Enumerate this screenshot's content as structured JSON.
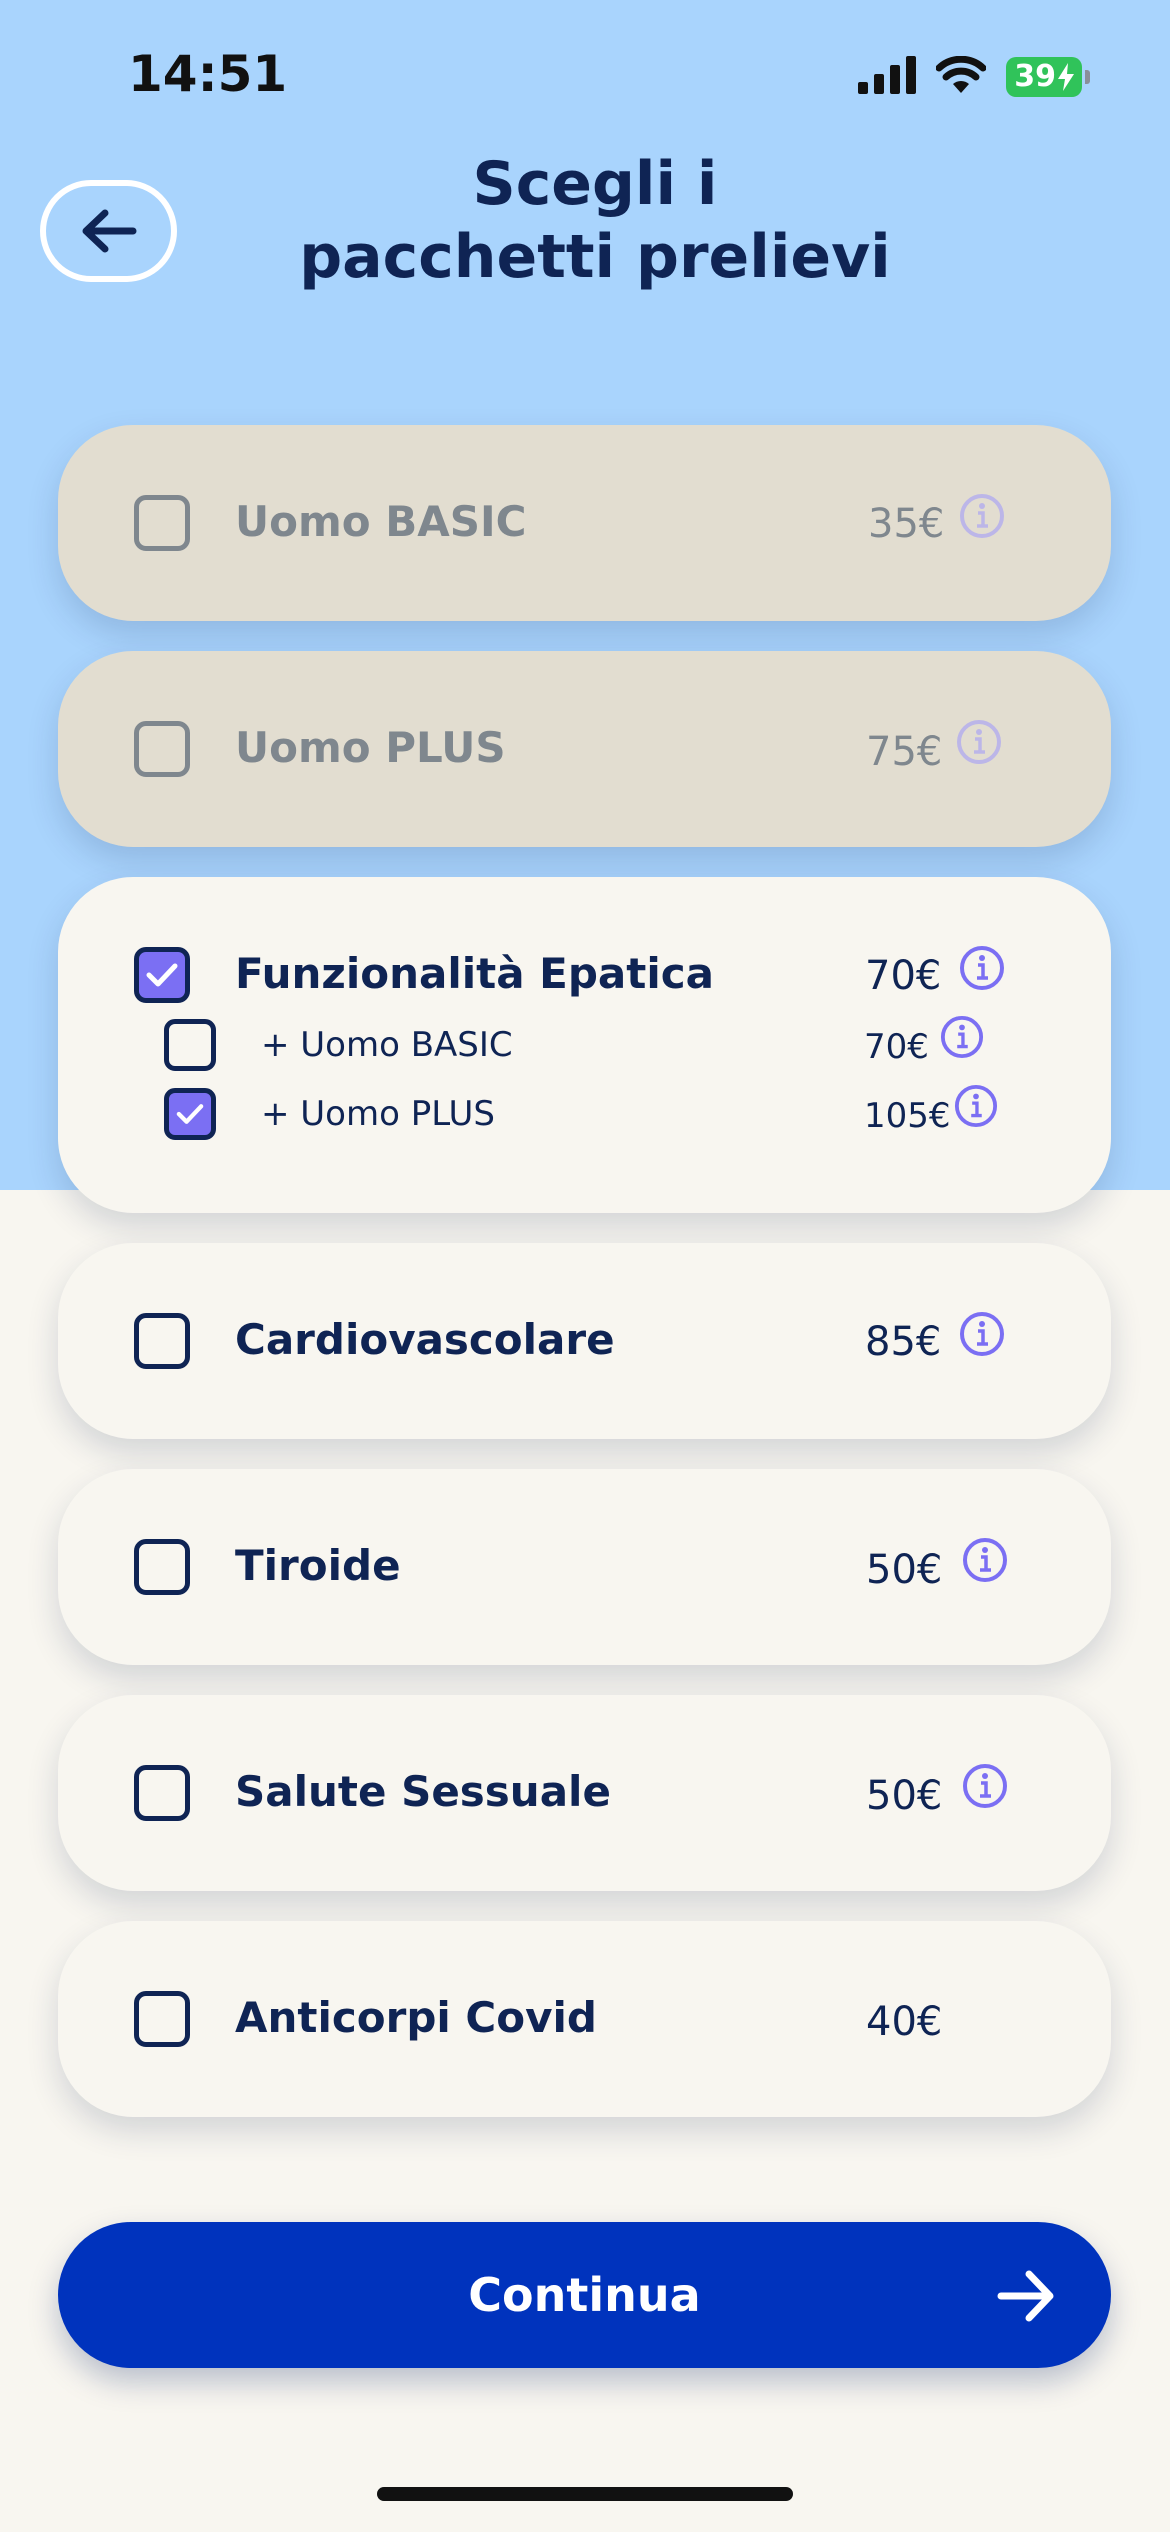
{
  "status_bar": {
    "time": "14:51",
    "battery": "39"
  },
  "header": {
    "title_line1": "Scegli i",
    "title_line2": "pacchetti prelievi"
  },
  "packages": [
    {
      "label": "Uomo BASIC",
      "price": "35€",
      "checked": false,
      "enabled": false
    },
    {
      "label": "Uomo PLUS",
      "price": "75€",
      "checked": false,
      "enabled": false
    },
    {
      "label": "Funzionalità Epatica",
      "price": "70€",
      "checked": true,
      "enabled": true,
      "addons": [
        {
          "label": "+ Uomo BASIC",
          "price": "70€",
          "checked": false
        },
        {
          "label": "+ Uomo PLUS",
          "price": "105€",
          "checked": true
        }
      ]
    },
    {
      "label": "Cardiovascolare",
      "price": "85€",
      "checked": false,
      "enabled": true
    },
    {
      "label": "Tiroide",
      "price": "50€",
      "checked": false,
      "enabled": true
    },
    {
      "label": "Salute Sessuale",
      "price": "50€",
      "checked": false,
      "enabled": true
    },
    {
      "label": "Anticorpi Covid",
      "price": "40€",
      "checked": false,
      "enabled": true
    }
  ],
  "continue_button": {
    "label": "Continua"
  },
  "colors": {
    "top_background": "#a9d4fd",
    "page_background": "#f8f6f0",
    "disabled_card": "#e2ddd0",
    "text_dark": "#0f2454",
    "accent_purple": "#7b6ff3",
    "primary_button": "#0033bd",
    "battery_green": "#30c35a"
  },
  "icons": {
    "back": "arrow-left-icon",
    "info": "info-circle-icon",
    "check": "check-icon",
    "continue": "arrow-right-icon"
  }
}
